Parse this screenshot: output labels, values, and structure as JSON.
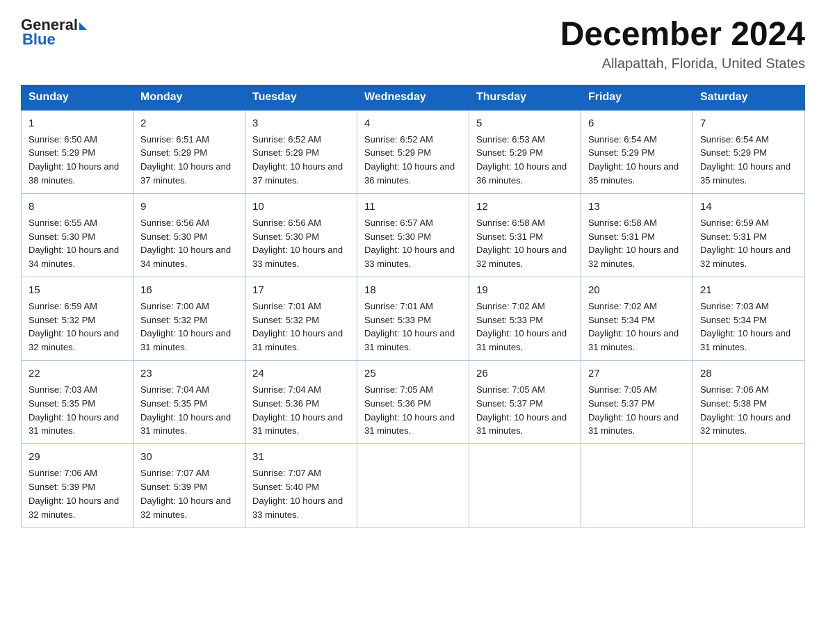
{
  "header": {
    "logo_general": "General",
    "logo_blue": "Blue",
    "month_title": "December 2024",
    "location": "Allapattah, Florida, United States"
  },
  "days_of_week": [
    "Sunday",
    "Monday",
    "Tuesday",
    "Wednesday",
    "Thursday",
    "Friday",
    "Saturday"
  ],
  "weeks": [
    [
      {
        "day": "1",
        "sunrise": "6:50 AM",
        "sunset": "5:29 PM",
        "daylight": "10 hours and 38 minutes."
      },
      {
        "day": "2",
        "sunrise": "6:51 AM",
        "sunset": "5:29 PM",
        "daylight": "10 hours and 37 minutes."
      },
      {
        "day": "3",
        "sunrise": "6:52 AM",
        "sunset": "5:29 PM",
        "daylight": "10 hours and 37 minutes."
      },
      {
        "day": "4",
        "sunrise": "6:52 AM",
        "sunset": "5:29 PM",
        "daylight": "10 hours and 36 minutes."
      },
      {
        "day": "5",
        "sunrise": "6:53 AM",
        "sunset": "5:29 PM",
        "daylight": "10 hours and 36 minutes."
      },
      {
        "day": "6",
        "sunrise": "6:54 AM",
        "sunset": "5:29 PM",
        "daylight": "10 hours and 35 minutes."
      },
      {
        "day": "7",
        "sunrise": "6:54 AM",
        "sunset": "5:29 PM",
        "daylight": "10 hours and 35 minutes."
      }
    ],
    [
      {
        "day": "8",
        "sunrise": "6:55 AM",
        "sunset": "5:30 PM",
        "daylight": "10 hours and 34 minutes."
      },
      {
        "day": "9",
        "sunrise": "6:56 AM",
        "sunset": "5:30 PM",
        "daylight": "10 hours and 34 minutes."
      },
      {
        "day": "10",
        "sunrise": "6:56 AM",
        "sunset": "5:30 PM",
        "daylight": "10 hours and 33 minutes."
      },
      {
        "day": "11",
        "sunrise": "6:57 AM",
        "sunset": "5:30 PM",
        "daylight": "10 hours and 33 minutes."
      },
      {
        "day": "12",
        "sunrise": "6:58 AM",
        "sunset": "5:31 PM",
        "daylight": "10 hours and 32 minutes."
      },
      {
        "day": "13",
        "sunrise": "6:58 AM",
        "sunset": "5:31 PM",
        "daylight": "10 hours and 32 minutes."
      },
      {
        "day": "14",
        "sunrise": "6:59 AM",
        "sunset": "5:31 PM",
        "daylight": "10 hours and 32 minutes."
      }
    ],
    [
      {
        "day": "15",
        "sunrise": "6:59 AM",
        "sunset": "5:32 PM",
        "daylight": "10 hours and 32 minutes."
      },
      {
        "day": "16",
        "sunrise": "7:00 AM",
        "sunset": "5:32 PM",
        "daylight": "10 hours and 31 minutes."
      },
      {
        "day": "17",
        "sunrise": "7:01 AM",
        "sunset": "5:32 PM",
        "daylight": "10 hours and 31 minutes."
      },
      {
        "day": "18",
        "sunrise": "7:01 AM",
        "sunset": "5:33 PM",
        "daylight": "10 hours and 31 minutes."
      },
      {
        "day": "19",
        "sunrise": "7:02 AM",
        "sunset": "5:33 PM",
        "daylight": "10 hours and 31 minutes."
      },
      {
        "day": "20",
        "sunrise": "7:02 AM",
        "sunset": "5:34 PM",
        "daylight": "10 hours and 31 minutes."
      },
      {
        "day": "21",
        "sunrise": "7:03 AM",
        "sunset": "5:34 PM",
        "daylight": "10 hours and 31 minutes."
      }
    ],
    [
      {
        "day": "22",
        "sunrise": "7:03 AM",
        "sunset": "5:35 PM",
        "daylight": "10 hours and 31 minutes."
      },
      {
        "day": "23",
        "sunrise": "7:04 AM",
        "sunset": "5:35 PM",
        "daylight": "10 hours and 31 minutes."
      },
      {
        "day": "24",
        "sunrise": "7:04 AM",
        "sunset": "5:36 PM",
        "daylight": "10 hours and 31 minutes."
      },
      {
        "day": "25",
        "sunrise": "7:05 AM",
        "sunset": "5:36 PM",
        "daylight": "10 hours and 31 minutes."
      },
      {
        "day": "26",
        "sunrise": "7:05 AM",
        "sunset": "5:37 PM",
        "daylight": "10 hours and 31 minutes."
      },
      {
        "day": "27",
        "sunrise": "7:05 AM",
        "sunset": "5:37 PM",
        "daylight": "10 hours and 31 minutes."
      },
      {
        "day": "28",
        "sunrise": "7:06 AM",
        "sunset": "5:38 PM",
        "daylight": "10 hours and 32 minutes."
      }
    ],
    [
      {
        "day": "29",
        "sunrise": "7:06 AM",
        "sunset": "5:39 PM",
        "daylight": "10 hours and 32 minutes."
      },
      {
        "day": "30",
        "sunrise": "7:07 AM",
        "sunset": "5:39 PM",
        "daylight": "10 hours and 32 minutes."
      },
      {
        "day": "31",
        "sunrise": "7:07 AM",
        "sunset": "5:40 PM",
        "daylight": "10 hours and 33 minutes."
      },
      null,
      null,
      null,
      null
    ]
  ]
}
